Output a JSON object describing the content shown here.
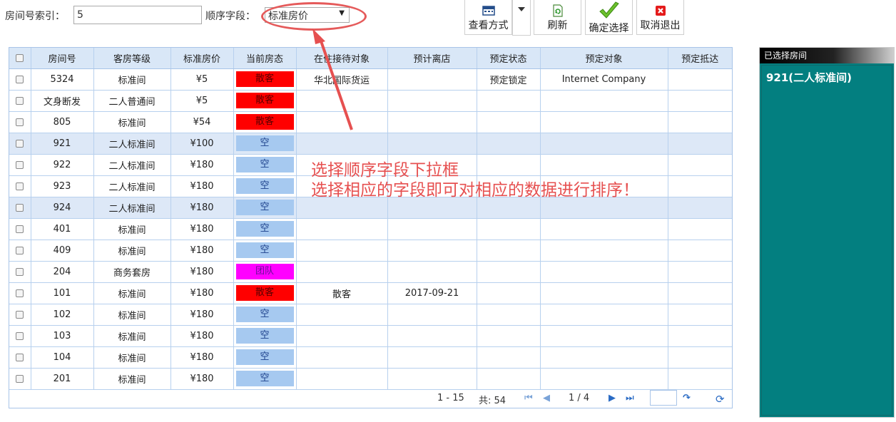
{
  "filter": {
    "index_label": "房间号索引：",
    "index_value": "5",
    "order_label": "顺序字段：",
    "order_selected": "标准房价"
  },
  "toolbar": {
    "view_label": "查看方式",
    "refresh_label": "刷新",
    "confirm_label": "确定选择",
    "cancel_label": "取消退出"
  },
  "grid": {
    "columns": [
      "房间号",
      "客房等级",
      "标准房价",
      "当前房态",
      "在住接待对象",
      "预计离店",
      "预定状态",
      "预定对象",
      "预定抵达"
    ],
    "rows": [
      {
        "room": "5324",
        "grade": "标准间",
        "price": "¥5",
        "status": "散客",
        "status_color": "#ff0000",
        "guest": "华北国际货运",
        "depart": "",
        "res_status": "预定锁定",
        "res_party": "Internet Company",
        "arrive": "",
        "selected": false
      },
      {
        "room": "文身断发",
        "grade": "二人普通间",
        "price": "¥5",
        "status": "散客",
        "status_color": "#ff0000",
        "guest": "",
        "depart": "",
        "res_status": "",
        "res_party": "",
        "arrive": "",
        "selected": false
      },
      {
        "room": "805",
        "grade": "标准间",
        "price": "¥54",
        "status": "散客",
        "status_color": "#ff0000",
        "guest": "",
        "depart": "",
        "res_status": "",
        "res_party": "",
        "arrive": "",
        "selected": false
      },
      {
        "room": "921",
        "grade": "二人标准间",
        "price": "¥100",
        "status": "空",
        "status_color": "#a6c9f0",
        "guest": "",
        "depart": "",
        "res_status": "",
        "res_party": "",
        "arrive": "",
        "selected": true
      },
      {
        "room": "922",
        "grade": "二人标准间",
        "price": "¥180",
        "status": "空",
        "status_color": "#a6c9f0",
        "guest": "",
        "depart": "",
        "res_status": "",
        "res_party": "",
        "arrive": "",
        "selected": false
      },
      {
        "room": "923",
        "grade": "二人标准间",
        "price": "¥180",
        "status": "空",
        "status_color": "#a6c9f0",
        "guest": "",
        "depart": "",
        "res_status": "",
        "res_party": "",
        "arrive": "",
        "selected": false
      },
      {
        "room": "924",
        "grade": "二人标准间",
        "price": "¥180",
        "status": "空",
        "status_color": "#a6c9f0",
        "guest": "",
        "depart": "",
        "res_status": "",
        "res_party": "",
        "arrive": "",
        "selected": true
      },
      {
        "room": "401",
        "grade": "标准间",
        "price": "¥180",
        "status": "空",
        "status_color": "#a6c9f0",
        "guest": "",
        "depart": "",
        "res_status": "",
        "res_party": "",
        "arrive": "",
        "selected": false
      },
      {
        "room": "409",
        "grade": "标准间",
        "price": "¥180",
        "status": "空",
        "status_color": "#a6c9f0",
        "guest": "",
        "depart": "",
        "res_status": "",
        "res_party": "",
        "arrive": "",
        "selected": false
      },
      {
        "room": "204",
        "grade": "商务套房",
        "price": "¥180",
        "status": "团队",
        "status_color": "#ff00ff",
        "guest": "",
        "depart": "",
        "res_status": "",
        "res_party": "",
        "arrive": "",
        "selected": false
      },
      {
        "room": "101",
        "grade": "标准间",
        "price": "¥180",
        "status": "散客",
        "status_color": "#ff0000",
        "guest": "散客",
        "depart": "2017-09-21",
        "res_status": "",
        "res_party": "",
        "arrive": "",
        "selected": false
      },
      {
        "room": "102",
        "grade": "标准间",
        "price": "¥180",
        "status": "空",
        "status_color": "#a6c9f0",
        "guest": "",
        "depart": "",
        "res_status": "",
        "res_party": "",
        "arrive": "",
        "selected": false
      },
      {
        "room": "103",
        "grade": "标准间",
        "price": "¥180",
        "status": "空",
        "status_color": "#a6c9f0",
        "guest": "",
        "depart": "",
        "res_status": "",
        "res_party": "",
        "arrive": "",
        "selected": false
      },
      {
        "room": "104",
        "grade": "标准间",
        "price": "¥180",
        "status": "空",
        "status_color": "#a6c9f0",
        "guest": "",
        "depart": "",
        "res_status": "",
        "res_party": "",
        "arrive": "",
        "selected": false
      },
      {
        "room": "201",
        "grade": "标准间",
        "price": "¥180",
        "status": "空",
        "status_color": "#a6c9f0",
        "guest": "",
        "depart": "",
        "res_status": "",
        "res_party": "",
        "arrive": "",
        "selected": false
      }
    ]
  },
  "pager": {
    "range": "1 - 15",
    "total": "共: 54",
    "pages": "1 / 4"
  },
  "selected_panel": {
    "title": "已选择房间",
    "items": [
      "921(二人标准间)"
    ]
  },
  "annotation": {
    "line1": "选择顺序字段下拉框",
    "line2": "选择相应的字段即可对相应的数据进行排序！"
  },
  "colors": {
    "header_bg": "#d9e7f7",
    "selected_row_bg": "#dde8f7",
    "panel_bg": "#037f80",
    "annotation": "#e65050"
  },
  "icons": [
    "view-mode-icon",
    "dropdown-caret-icon",
    "refresh-icon",
    "confirm-check-icon",
    "cancel-x-icon",
    "first-page-icon",
    "prev-page-icon",
    "next-page-icon",
    "last-page-icon",
    "go-icon",
    "reload-icon"
  ]
}
